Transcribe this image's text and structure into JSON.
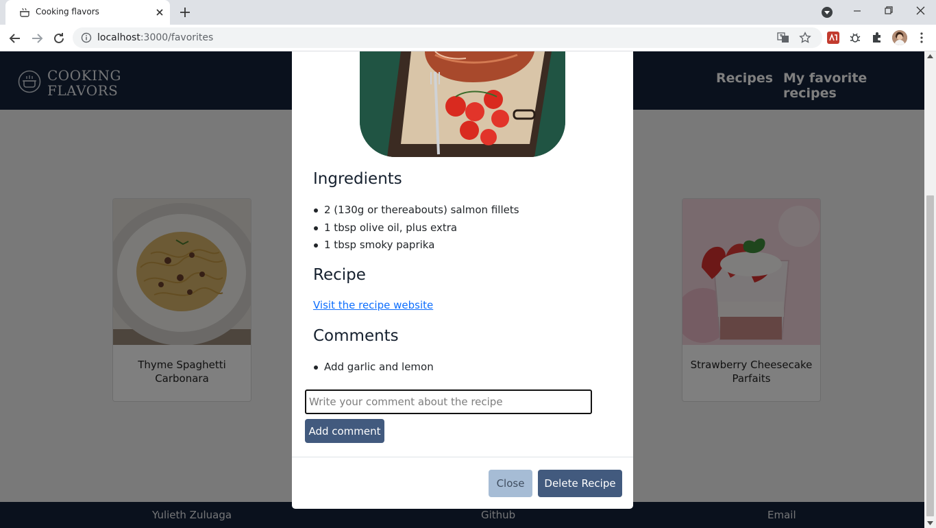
{
  "browser": {
    "tab_title": "Cooking flavors",
    "url_host": "localhost",
    "url_path": ":3000/favorites",
    "icons": [
      "cooking-pot-icon",
      "close-icon",
      "plus-icon",
      "chevron-down-icon",
      "minimize-icon",
      "restore-icon",
      "close-icon",
      "back-arrow-icon",
      "forward-arrow-icon",
      "reload-icon",
      "info-icon",
      "translate-icon",
      "star-icon",
      "puzzle-icon",
      "kebab-menu-icon"
    ]
  },
  "header": {
    "logo_line1": "COOKING",
    "logo_line2": "FLAVORS",
    "nav": [
      "Recipes",
      "My favorite recipes"
    ]
  },
  "cards": [
    {
      "title": "Thyme Spaghetti Carbonara"
    },
    {
      "title": "Strawberry Cheesecake Parfaits"
    }
  ],
  "modal": {
    "ingredients_heading": "Ingredients",
    "ingredients": [
      "2 (130g or thereabouts) salmon fillets",
      "1 tbsp olive oil, plus extra",
      "1 tbsp smoky paprika"
    ],
    "recipe_heading": "Recipe",
    "recipe_link": "Visit the recipe website",
    "comments_heading": "Comments",
    "comments": [
      "Add garlic and lemon"
    ],
    "comment_placeholder": "Write your comment about the recipe",
    "add_comment_label": "Add comment",
    "close_label": "Close",
    "delete_label": "Delete Recipe"
  },
  "footer": {
    "author": "Yulieth Zuluaga",
    "github": "Github",
    "email": "Email"
  },
  "colors": {
    "header_bg": "#14223a",
    "primary_button": "#425a7e",
    "close_button": "#a6bcd5",
    "link": "#0d6efd"
  }
}
